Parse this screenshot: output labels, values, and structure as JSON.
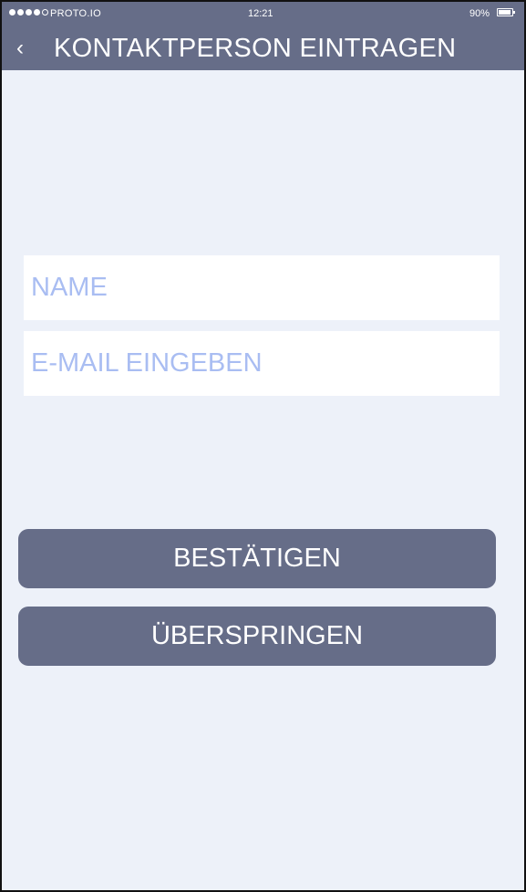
{
  "status_bar": {
    "carrier": "PROTO.IO",
    "time": "12:21",
    "battery_percent": "90%",
    "signal_strength_filled": 4,
    "signal_strength_total": 5
  },
  "header": {
    "back_label": "‹",
    "title": "KONTAKTPERSON EINTRAGEN"
  },
  "form": {
    "name_placeholder": "NAME",
    "email_placeholder": "E-MAIL EINGEBEN"
  },
  "actions": {
    "confirm_label": "BESTÄTIGEN",
    "skip_label": "ÜBERSPRINGEN"
  },
  "colors": {
    "accent": "#666d88",
    "background": "#edf1f9",
    "placeholder": "#a9bdf2"
  }
}
